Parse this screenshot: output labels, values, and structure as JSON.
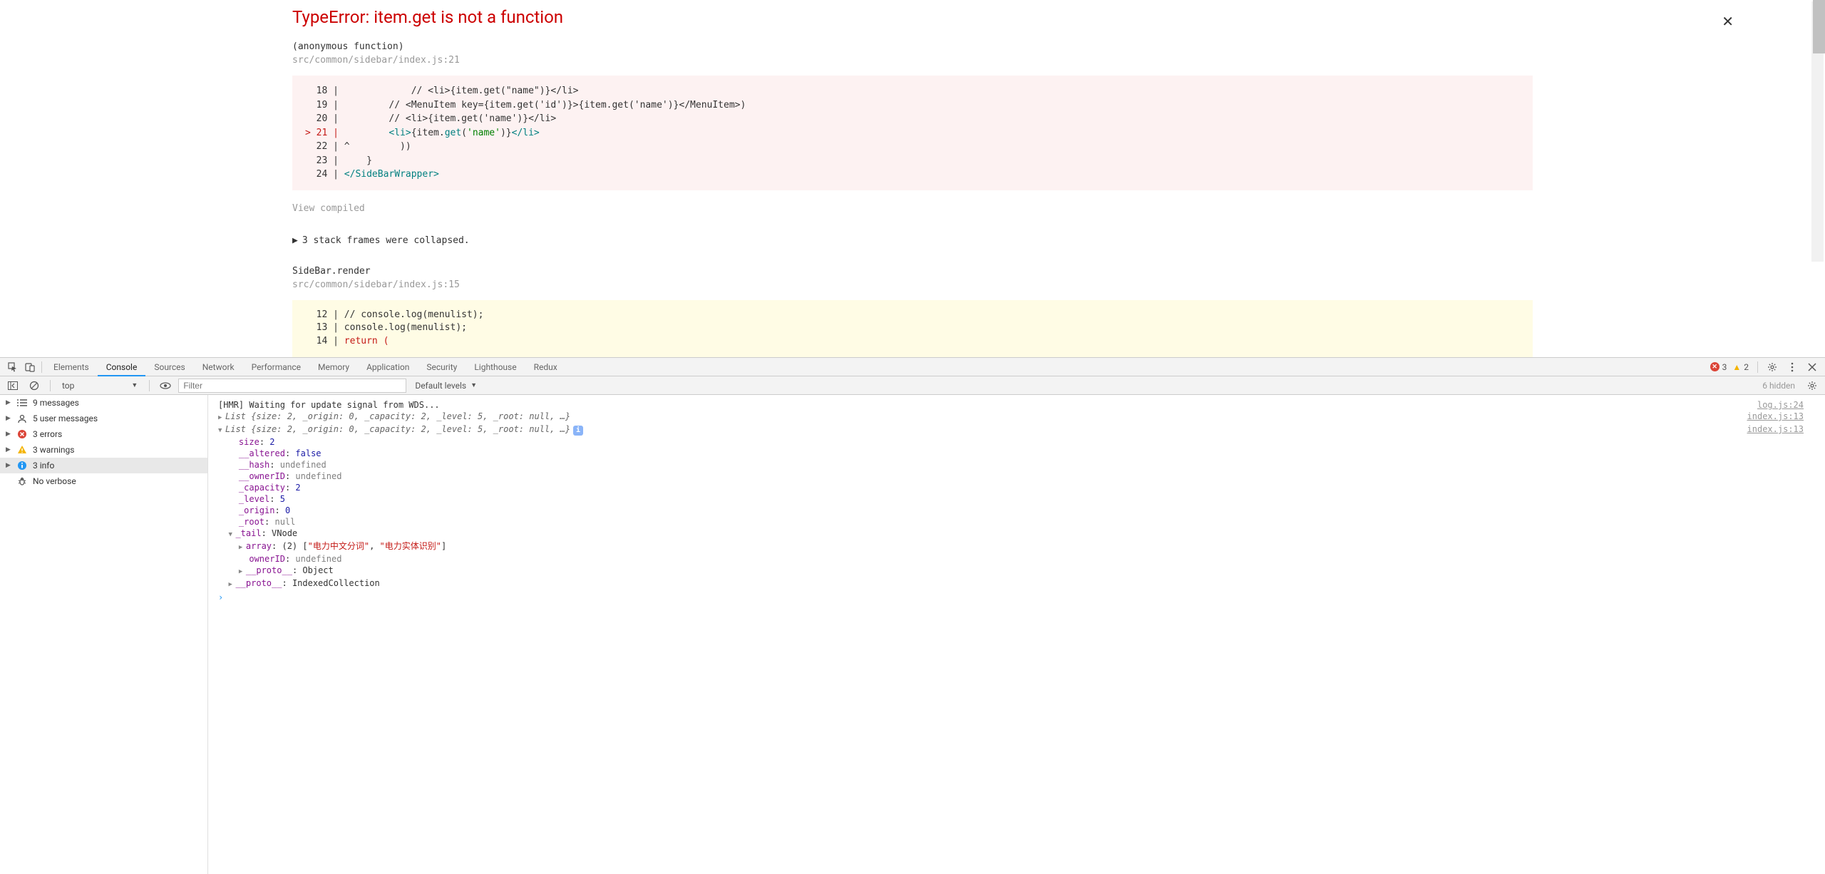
{
  "error": {
    "title": "TypeError: item.get is not a function",
    "anon": "(anonymous function)",
    "path1": "src/common/sidebar/index.js:21",
    "view_compiled": "View compiled",
    "collapsed": "3 stack frames were collapsed.",
    "render": "SideBar.render",
    "path2": "src/common/sidebar/index.js:15"
  },
  "code1": {
    "l18": "  18 |             // <li>{item.get(\"name\")}</li>",
    "l19": "  19 |         // <MenuItem key={item.get('id')}>{item.get('name')}</MenuItem>)",
    "l20": "  20 |         // <li>{item.get('name')}</li>",
    "l21a": "> 21 |         ",
    "l21b": "<li>",
    "l21c": "{item.",
    "l21d": "get",
    "l21e": "(",
    "l21f": "'name'",
    "l21g": ")}",
    "l21h": "</li>",
    "l22": "  22 | ^         ))",
    "l23": "  23 |     }",
    "l24a": "  24 | ",
    "l24b": "</SideBarWrapper>"
  },
  "code2": {
    "l12": "  12 | // console.log(menulist);",
    "l13": "  13 | console.log(menulist);",
    "l14a": "  14 | ",
    "l14b": "return ("
  },
  "devtools": {
    "tabs": [
      "Elements",
      "Console",
      "Sources",
      "Network",
      "Performance",
      "Memory",
      "Application",
      "Security",
      "Lighthouse",
      "Redux"
    ],
    "active_tab": 1,
    "err_count": "3",
    "warn_count": "2",
    "context": "top",
    "filter_placeholder": "Filter",
    "default_levels": "Default levels",
    "hidden": "6 hidden"
  },
  "sidebar": {
    "items": [
      {
        "icon": "list",
        "label": "9 messages"
      },
      {
        "icon": "user",
        "label": "5 user messages"
      },
      {
        "icon": "error",
        "label": "3 errors"
      },
      {
        "icon": "warning",
        "label": "3 warnings"
      },
      {
        "icon": "info",
        "label": "3 info"
      },
      {
        "icon": "bug",
        "label": "No verbose"
      }
    ]
  },
  "console": {
    "hmr": "[HMR] Waiting for update signal from WDS...",
    "hmr_src": "log.js:24",
    "list1": "List {size: 2, _origin: 0, _capacity: 2, _level: 5, _root: null, …}",
    "list1_src": "index.js:13",
    "list2": "List {size: 2, _origin: 0, _capacity: 2, _level: 5, _root: null, …}",
    "list2_src": "index.js:13",
    "props": {
      "size_k": "size",
      "size_v": "2",
      "altered_k": "__altered",
      "altered_v": "false",
      "hash_k": "__hash",
      "hash_v": "undefined",
      "owner_k": "__ownerID",
      "owner_v": "undefined",
      "cap_k": "_capacity",
      "cap_v": "2",
      "level_k": "_level",
      "level_v": "5",
      "origin_k": "_origin",
      "origin_v": "0",
      "root_k": "_root",
      "root_v": "null",
      "tail_k": "_tail",
      "tail_v": "VNode",
      "array_k": "array",
      "array_pre": "(2) [",
      "array_s1": "\"电力中文分词\"",
      "array_sep": ", ",
      "array_s2": "\"电力实体识别\"",
      "array_post": "]",
      "ownerid_k": "ownerID",
      "ownerid_v": "undefined",
      "proto1_k": "__proto__",
      "proto1_v": "Object",
      "proto2_k": "__proto__",
      "proto2_v": "IndexedCollection"
    }
  }
}
